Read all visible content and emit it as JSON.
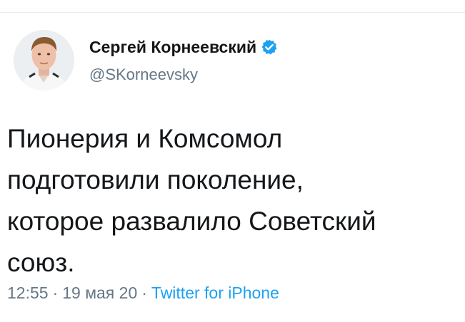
{
  "user": {
    "display_name": "Сергей Корнеевский",
    "handle": "@SKorneevsky",
    "verified": true,
    "avatar_icon": "profile-photo-avatar"
  },
  "tweet": {
    "lines": [
      "Пионерия и Комсомол",
      "подготовили поколение,",
      "которое развалило Советский",
      "союз."
    ]
  },
  "meta": {
    "time": "12:55",
    "separator": "·",
    "date": "19 мая 20",
    "source": "Twitter for iPhone"
  },
  "colors": {
    "text_primary": "#14171a",
    "text_secondary": "#657786",
    "accent": "#1da1f2",
    "divider": "#e6ecf0"
  }
}
